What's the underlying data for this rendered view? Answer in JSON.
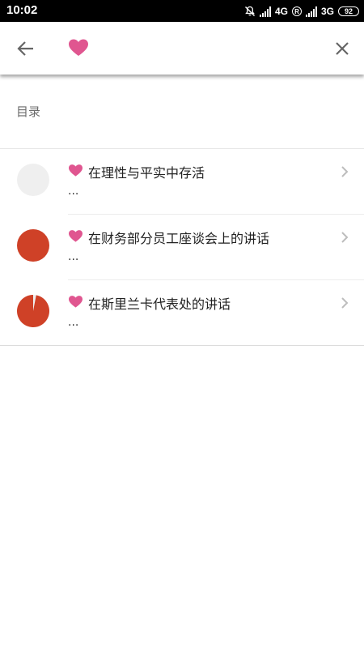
{
  "status_bar": {
    "time": "10:02",
    "network_1": "4G",
    "roaming": "R",
    "network_2": "3G",
    "battery": "92"
  },
  "header": {
    "back_icon": "arrow-left-icon",
    "title_icon": "heart-icon",
    "close_icon": "close-icon"
  },
  "section": {
    "label": "目录"
  },
  "items": [
    {
      "title": "在理性与平实中存活",
      "subtitle": "...",
      "progress": 0.0,
      "icon": "heart-icon"
    },
    {
      "title": "在财务部分员工座谈会上的讲话",
      "subtitle": "...",
      "progress": 1.0,
      "icon": "heart-icon"
    },
    {
      "title": "在斯里兰卡代表处的讲话",
      "subtitle": "...",
      "progress": 0.97,
      "icon": "heart-icon"
    }
  ],
  "colors": {
    "heart": "#e05690",
    "progress_fill": "#cf4127",
    "progress_empty": "#efefef",
    "chevron": "#bdbdbd"
  }
}
